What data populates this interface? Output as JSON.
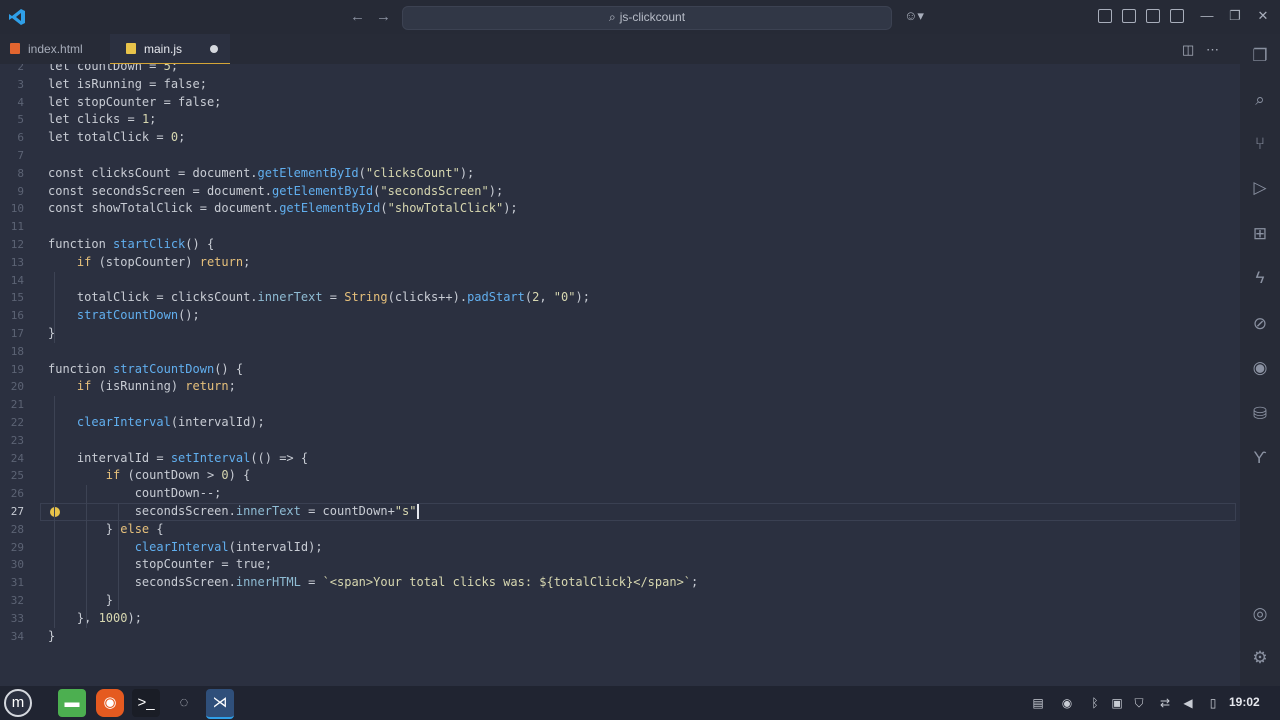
{
  "titlebar": {
    "search_text": "js-clickcount"
  },
  "tabs": [
    {
      "label": "index.html",
      "icon": "html-file-icon"
    },
    {
      "label": "main.js",
      "icon": "js-file-icon",
      "modified": true
    }
  ],
  "editor": {
    "active_line": 27,
    "lines": [
      {
        "n": "2",
        "html": "<span class='kw2'>let</span> countDown = <span class='num'>5</span>;"
      },
      {
        "n": "3",
        "html": "<span class='kw2'>let</span> isRunning = false;"
      },
      {
        "n": "4",
        "html": "<span class='kw2'>let</span> stopCounter = false;"
      },
      {
        "n": "5",
        "html": "<span class='kw2'>let</span> clicks = <span class='num'>1</span>;"
      },
      {
        "n": "6",
        "html": "<span class='kw2'>let</span> totalClick = <span class='num'>0</span>;"
      },
      {
        "n": "7",
        "html": ""
      },
      {
        "n": "8",
        "html": "<span class='kw2'>const</span> clicksCount = document.<span class='fn'>getElementById</span>(<span class='str'>\"clicksCount\"</span>);"
      },
      {
        "n": "9",
        "html": "<span class='kw2'>const</span> secondsScreen = document.<span class='fn'>getElementById</span>(<span class='str'>\"secondsScreen\"</span>);"
      },
      {
        "n": "10",
        "html": "<span class='kw2'>const</span> showTotalClick = document.<span class='fn'>getElementById</span>(<span class='str'>\"showTotalClick\"</span>);"
      },
      {
        "n": "11",
        "html": ""
      },
      {
        "n": "12",
        "html": "<span class='kw2'>function</span> <span class='fn'>startClick</span>() {"
      },
      {
        "n": "13",
        "html": "    <span class='kw'>if</span> (stopCounter) <span class='kw'>return</span>;"
      },
      {
        "n": "14",
        "html": ""
      },
      {
        "n": "15",
        "html": "    totalClick = clicksCount.<span class='prop'>innerText</span> = <span class='kw'>String</span>(clicks++).<span class='fn'>padStart</span>(<span class='num'>2</span>, <span class='str'>\"0\"</span>);"
      },
      {
        "n": "16",
        "html": "    <span class='fn'>stratCountDown</span>();"
      },
      {
        "n": "17",
        "html": "}"
      },
      {
        "n": "18",
        "html": ""
      },
      {
        "n": "19",
        "html": "<span class='kw2'>function</span> <span class='fn'>stratCountDown</span>() {"
      },
      {
        "n": "20",
        "html": "    <span class='kw'>if</span> (isRunning) <span class='kw'>return</span>;"
      },
      {
        "n": "21",
        "html": ""
      },
      {
        "n": "22",
        "html": "    <span class='fn'>clearInterval</span>(intervalId);"
      },
      {
        "n": "23",
        "html": ""
      },
      {
        "n": "24",
        "html": "    intervalId = <span class='fn'>setInterval</span>(() => {"
      },
      {
        "n": "25",
        "html": "        <span class='kw'>if</span> (countDown > <span class='num'>0</span>) {"
      },
      {
        "n": "26",
        "html": "            countDown--;"
      },
      {
        "n": "27",
        "html": "            secondsScreen.<span class='prop'>innerText</span> = countDown+<span class='str'>\"s\"</span>"
      },
      {
        "n": "28",
        "html": "        } <span class='kw'>else</span> {"
      },
      {
        "n": "29",
        "html": "            <span class='fn'>clearInterval</span>(intervalId);"
      },
      {
        "n": "30",
        "html": "            stopCounter = true;"
      },
      {
        "n": "31",
        "html": "            secondsScreen.<span class='prop'>innerHTML</span> = <span class='str'>`&lt;span&gt;Your total clicks was: ${totalClick}&lt;/span&gt;`</span>;"
      },
      {
        "n": "32",
        "html": "        }"
      },
      {
        "n": "33",
        "html": "    }, <span class='num'>1000</span>);"
      },
      {
        "n": "34",
        "html": "}"
      }
    ]
  },
  "taskbar": {
    "clock": "19:02"
  },
  "colors": {
    "accent": "#2f9fe8",
    "background": "#2b3040",
    "modified_tab_border": "#d4a537"
  }
}
